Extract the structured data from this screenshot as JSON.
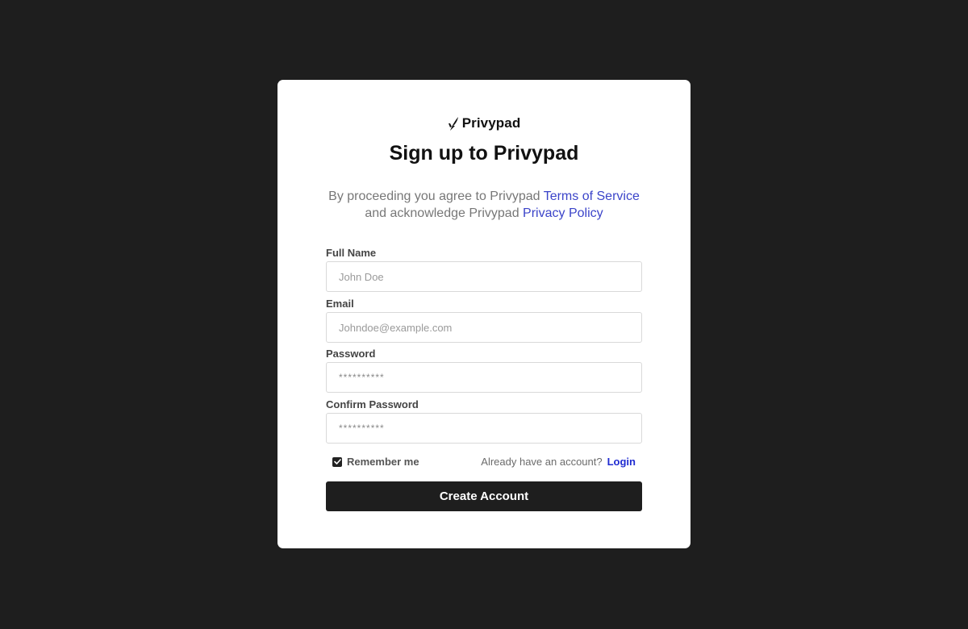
{
  "brand": {
    "name": "Privypad",
    "logo_icon": "privypad-logo-icon"
  },
  "header": {
    "title": "Sign up to Privypad"
  },
  "agreement": {
    "text_before_terms": "By proceeding you agree to Privypad ",
    "terms_link": "Terms of Service",
    "text_before_privacy": "and acknowledge Privypad ",
    "privacy_link": "Privacy Policy"
  },
  "form": {
    "full_name": {
      "label": "Full Name",
      "placeholder": "John Doe",
      "value": ""
    },
    "email": {
      "label": "Email",
      "placeholder": "Johndoe@example.com",
      "value": ""
    },
    "password": {
      "label": "Password",
      "placeholder": "**********",
      "value": ""
    },
    "confirm_password": {
      "label": "Confirm Password",
      "placeholder": "**********",
      "value": ""
    }
  },
  "remember": {
    "label": "Remember me",
    "checked": true
  },
  "account": {
    "prompt": "Already have an account?",
    "login_link": "Login"
  },
  "submit": {
    "label": "Create Account"
  },
  "colors": {
    "background": "#1e1e1e",
    "card": "#ffffff",
    "link": "#3b44c9",
    "login_link": "#1f2bd1",
    "button": "#1e1e1e"
  }
}
